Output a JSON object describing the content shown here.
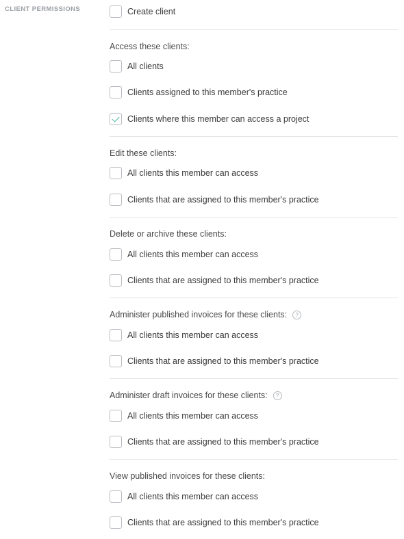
{
  "section": {
    "label": "CLIENT PERMISSIONS"
  },
  "create_client": {
    "label": "Create client",
    "checked": false
  },
  "groups": [
    {
      "title": "Access these clients:",
      "options": [
        {
          "label": "All clients",
          "checked": false
        },
        {
          "label": "Clients assigned to this member's practice",
          "checked": false
        },
        {
          "label": "Clients where this member can access a project",
          "checked": true
        }
      ]
    },
    {
      "title": "Edit these clients:",
      "options": [
        {
          "label": "All clients this member can access",
          "checked": false
        },
        {
          "label": "Clients that are assigned to this member's practice",
          "checked": false
        }
      ]
    },
    {
      "title": "Delete or archive these clients:",
      "options": [
        {
          "label": "All clients this member can access",
          "checked": false
        },
        {
          "label": "Clients that are assigned to this member's practice",
          "checked": false
        }
      ]
    },
    {
      "title": "Administer published invoices for these clients:",
      "help": "?",
      "options": [
        {
          "label": "All clients this member can access",
          "checked": false
        },
        {
          "label": "Clients that are assigned to this member's practice",
          "checked": false
        }
      ]
    },
    {
      "title": "Administer draft invoices for these clients:",
      "help": "?",
      "options": [
        {
          "label": "All clients this member can access",
          "checked": false
        },
        {
          "label": "Clients that are assigned to this member's practice",
          "checked": false
        }
      ]
    },
    {
      "title": "View published invoices for these clients:",
      "options": [
        {
          "label": "All clients this member can access",
          "checked": false
        },
        {
          "label": "Clients that are assigned to this member's practice",
          "checked": false
        }
      ]
    }
  ]
}
